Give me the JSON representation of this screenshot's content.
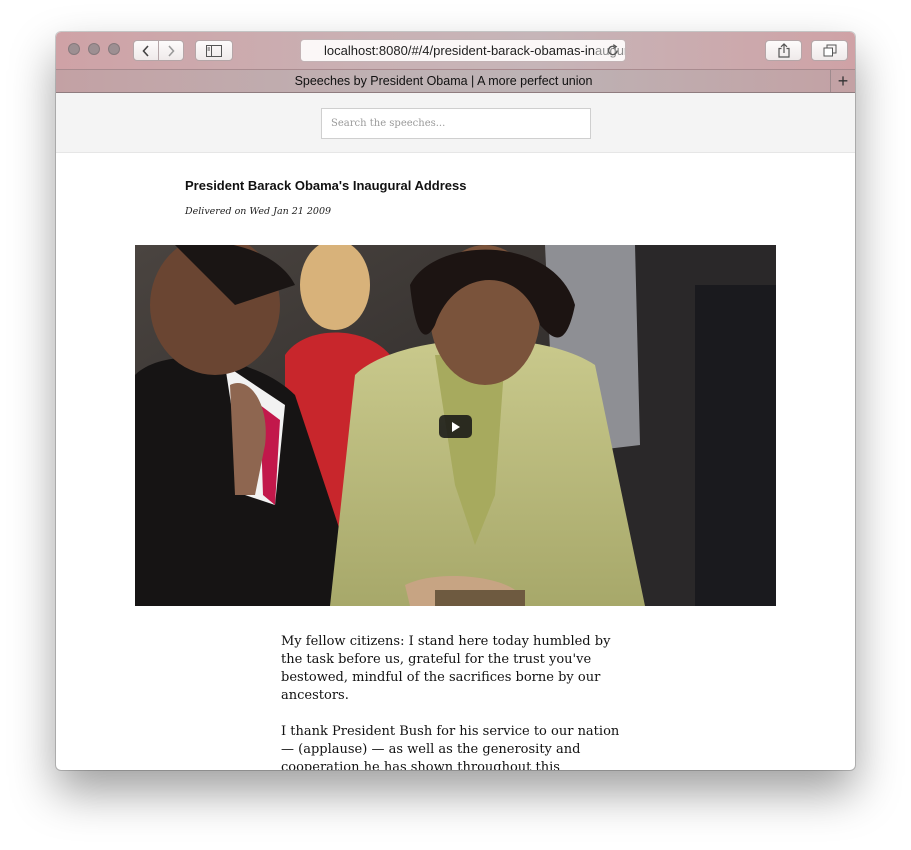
{
  "browser": {
    "url_main": "localhost:8080/#/4/president-barack-obamas-in",
    "url_fade": "augural-address",
    "tab_title": "Speeches by President Obama | A more perfect union",
    "new_tab_glyph": "+"
  },
  "search": {
    "placeholder": "Search the speeches..."
  },
  "speech": {
    "title": "President Barack Obama's Inaugural Address",
    "delivered": "Delivered on Wed Jan 21 2009",
    "paragraphs": [
      "My fellow citizens: I stand here today humbled by the task before us, grateful for the trust you've bestowed, mindful of the sacrifices borne by our ancestors.",
      "I thank President Bush for his service to our nation — (applause) — as well as the generosity and cooperation he has shown throughout this transition."
    ]
  },
  "icons": {
    "back": "chevron-left-icon",
    "forward": "chevron-right-icon",
    "sidebar": "sidebar-icon",
    "reload": "reload-icon",
    "share": "share-icon",
    "tabs": "tabs-overview-icon",
    "play": "play-icon"
  }
}
